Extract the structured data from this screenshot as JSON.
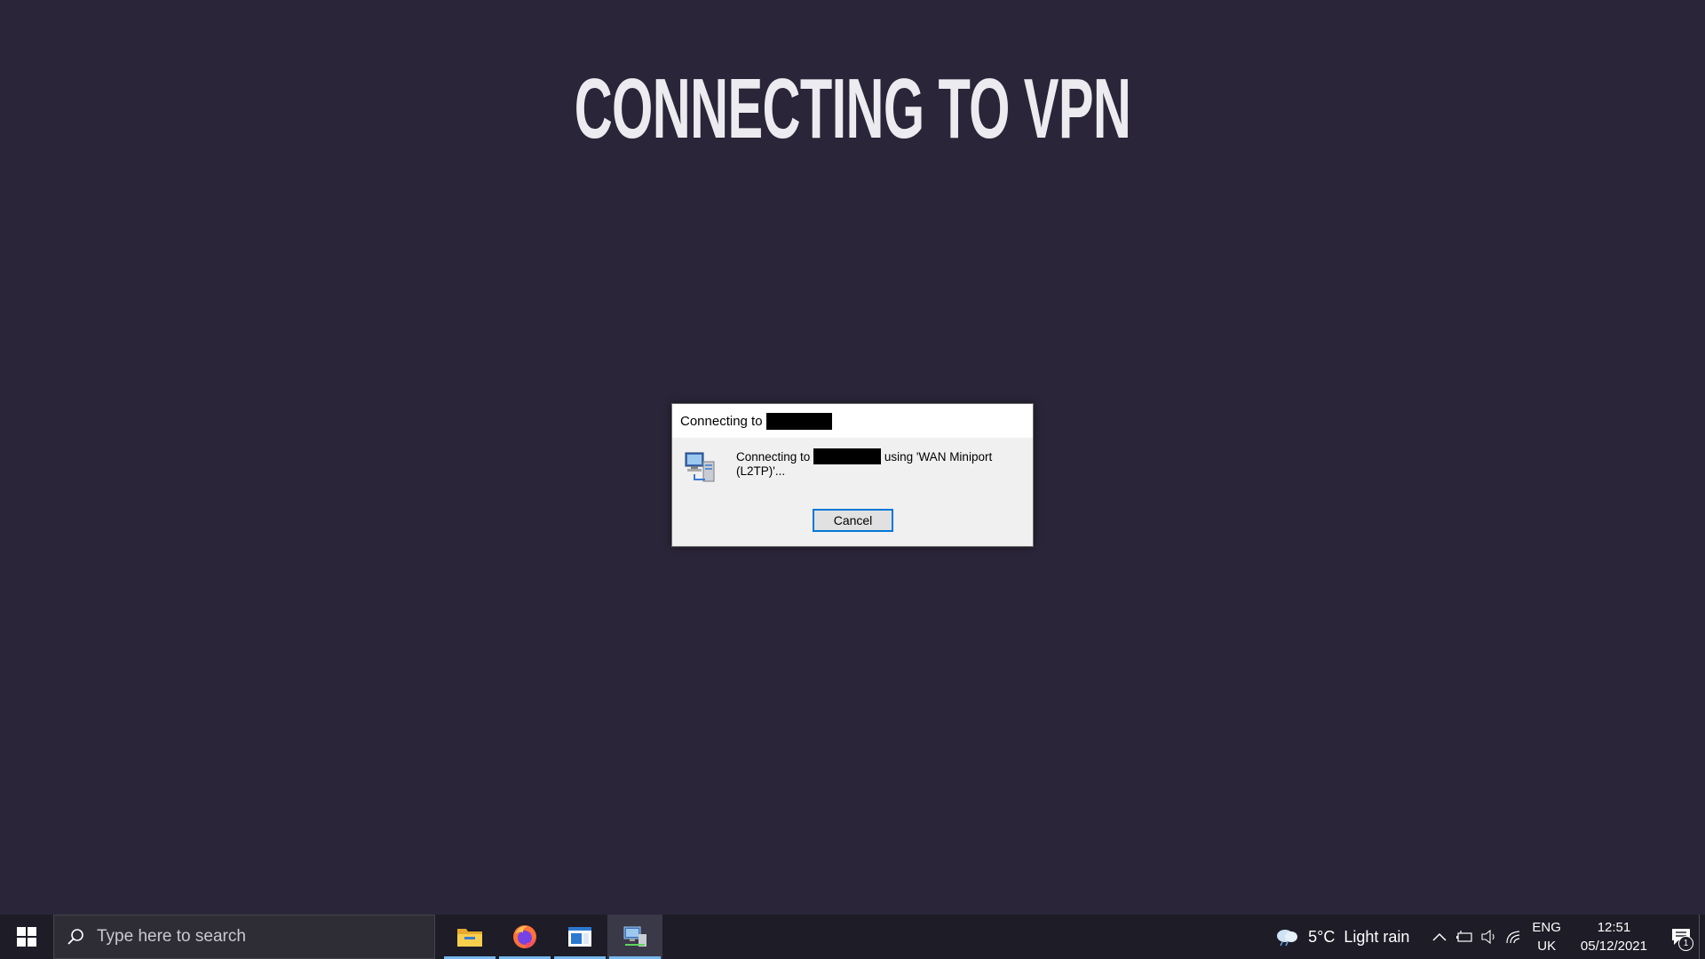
{
  "page": {
    "title": "CONNECTING TO VPN",
    "background": "#2a2538"
  },
  "dialog": {
    "title_prefix": "Connecting to",
    "message_prefix": "Connecting to",
    "message_suffix": "using 'WAN Miniport (L2TP)'...",
    "cancel_label": "Cancel",
    "icon": "network-connection-icon"
  },
  "taskbar": {
    "start_icon": "windows-logo-icon",
    "search_placeholder": "Type here to search",
    "apps": [
      {
        "name": "File Explorer",
        "icon": "file-explorer-icon",
        "running": true,
        "active": false
      },
      {
        "name": "Firefox",
        "icon": "firefox-icon",
        "running": true,
        "active": false
      },
      {
        "name": "Window app",
        "icon": "window-app-icon",
        "running": true,
        "active": false
      },
      {
        "name": "Network connection",
        "icon": "network-connection-icon",
        "running": true,
        "active": true
      }
    ],
    "weather": {
      "icon": "cloud-rain-icon",
      "temperature": "5°C",
      "description": "Light rain"
    },
    "tray_icons": [
      "chevron-up-icon",
      "battery-icon",
      "speaker-icon",
      "wifi-icon"
    ],
    "language": {
      "lang": "ENG",
      "region": "UK"
    },
    "clock": {
      "time": "12:51",
      "date": "05/12/2021"
    },
    "notification_count": "1",
    "accent_color": "#76b9ed"
  }
}
